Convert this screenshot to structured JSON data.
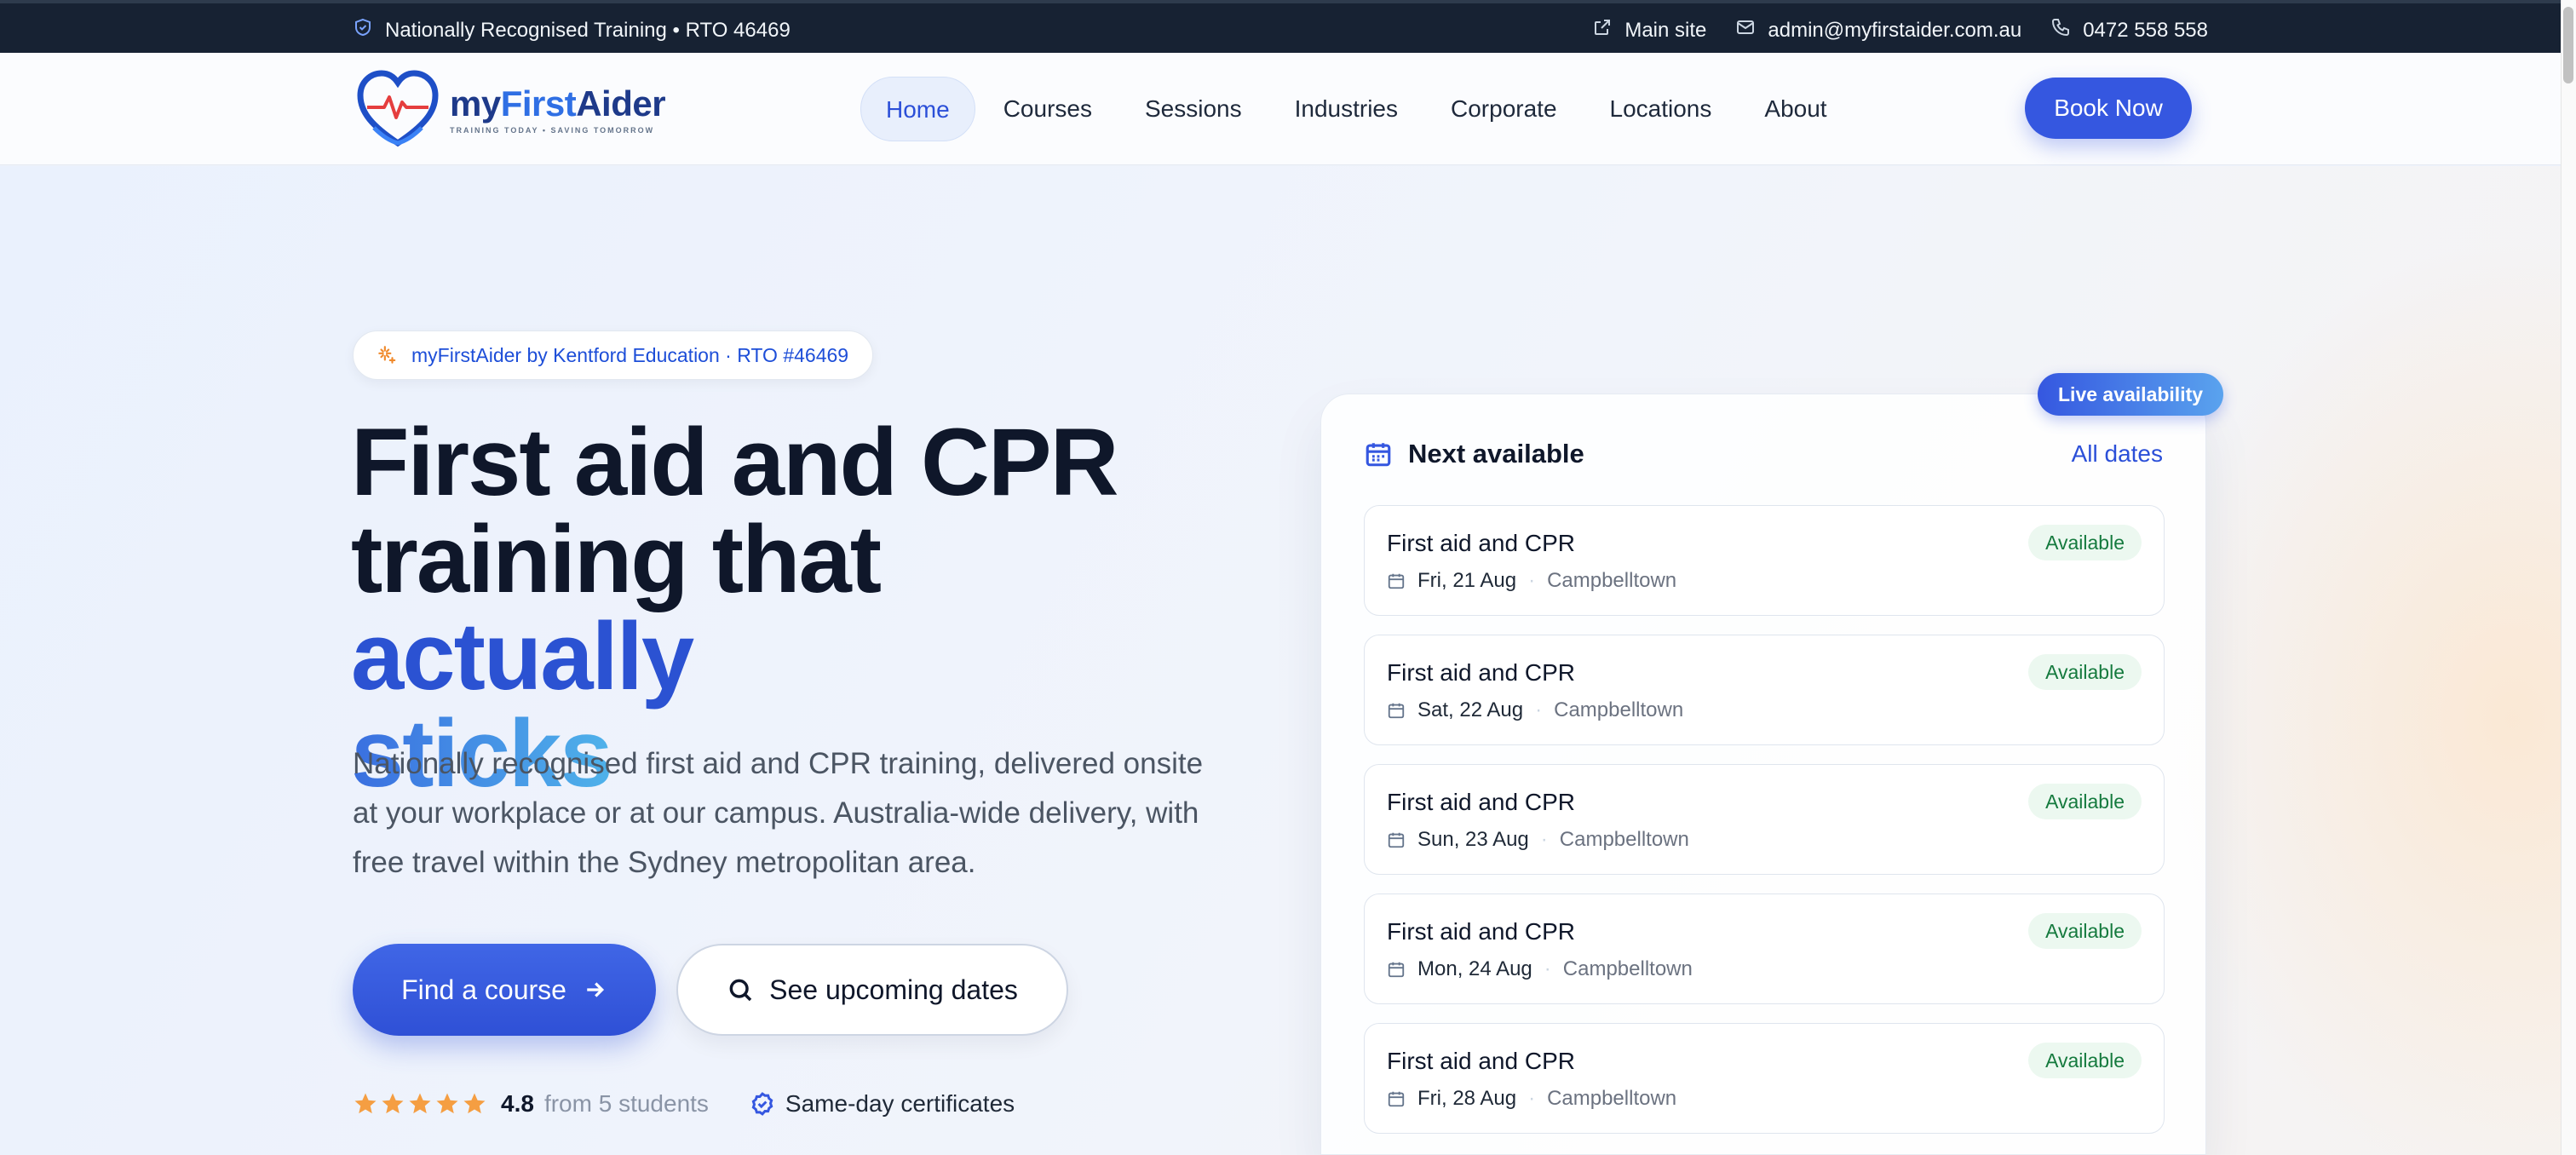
{
  "topbar": {
    "accreditation": "Nationally Recognised Training • RTO 46469",
    "main_site": "Main site",
    "email": "admin@myfirstaider.com.au",
    "phone": "0472 558 558"
  },
  "logo": {
    "brand_prefix": "my",
    "brand_first": "First",
    "brand_suffix": "Aider",
    "tagline": "TRAINING TODAY • SAVING TOMORROW"
  },
  "nav": {
    "items": [
      "Home",
      "Courses",
      "Sessions",
      "Industries",
      "Corporate",
      "Locations",
      "About"
    ],
    "active": "Home",
    "book_now": "Book Now"
  },
  "hero": {
    "pill": "myFirstAider by Kentford Education · RTO #46469",
    "headline_1": "First aid and CPR",
    "headline_2": "training that ",
    "headline_accent_1": "actually",
    "headline_accent_2": "sticks",
    "lead": "Nationally recognised first aid and CPR training, delivered onsite at your workplace or at our campus. Australia-wide delivery, with free travel within the Sydney metropolitan area.",
    "cta_primary": "Find a course",
    "cta_secondary": "See upcoming dates",
    "rating_value": "4.8",
    "rating_stars": 5,
    "rating_from": "from 5 students",
    "certificates": "Same-day certificates"
  },
  "availability": {
    "live_badge": "Live availability",
    "title": "Next available",
    "all_dates": "All dates",
    "sessions": [
      {
        "course": "First aid and CPR",
        "date": "Fri, 21 Aug",
        "location": "Campbelltown",
        "status": "Available"
      },
      {
        "course": "First aid and CPR",
        "date": "Sat, 22 Aug",
        "location": "Campbelltown",
        "status": "Available"
      },
      {
        "course": "First aid and CPR",
        "date": "Sun, 23 Aug",
        "location": "Campbelltown",
        "status": "Available"
      },
      {
        "course": "First aid and CPR",
        "date": "Mon, 24 Aug",
        "location": "Campbelltown",
        "status": "Available"
      },
      {
        "course": "First aid and CPR",
        "date": "Fri, 28 Aug",
        "location": "Campbelltown",
        "status": "Available"
      }
    ]
  },
  "colors": {
    "primary": "#3557e0",
    "topbar_bg": "#172233",
    "available_bg": "#ecf8f0",
    "available_text": "#157a3e",
    "star": "#f59e42"
  },
  "icons": {
    "accreditation": "shield-check-icon",
    "main_site": "external-link-icon",
    "email": "mail-icon",
    "phone": "phone-icon",
    "pill": "sparkles-icon",
    "cta_primary": "arrow-right-icon",
    "cta_secondary": "search-icon",
    "card_title": "calendar-icon",
    "session_date": "calendar-icon",
    "certificates": "check-circle-icon"
  }
}
